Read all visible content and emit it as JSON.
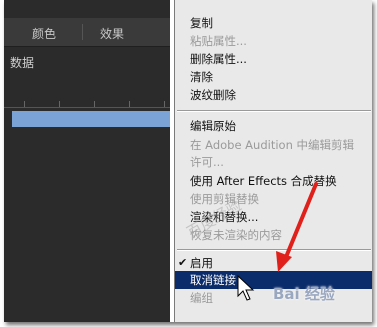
{
  "left_panel": {
    "tabs": [
      "颜色",
      "效果"
    ],
    "meta_label": "数据",
    "clip_color": "#7ba3d6"
  },
  "menu": {
    "items": [
      {
        "label": "复制",
        "enabled": true
      },
      {
        "label": "粘贴属性...",
        "enabled": false
      },
      {
        "label": "删除属性...",
        "enabled": true
      },
      {
        "label": "清除",
        "enabled": true
      },
      {
        "label": "波纹删除",
        "enabled": true
      },
      {
        "label": "编辑原始",
        "enabled": true
      },
      {
        "label": "在 Adobe Audition 中编辑剪辑",
        "enabled": false
      },
      {
        "label": "许可...",
        "enabled": false
      },
      {
        "label": "使用 After Effects 合成替换",
        "enabled": true
      },
      {
        "label": "使用剪辑替换",
        "enabled": false
      },
      {
        "label": "渲染和替换...",
        "enabled": true
      },
      {
        "label": "恢复未渲染的内容",
        "enabled": false
      },
      {
        "label": "启用",
        "enabled": true,
        "checked": true
      },
      {
        "label": "取消链接",
        "enabled": true,
        "selected": true
      },
      {
        "label": "编组",
        "enabled": false
      }
    ],
    "selected_color": "#0b2c6b"
  },
  "annotation": {
    "arrow_color": "#e0201a",
    "watermark": "百度经验",
    "logo": "Bai 经验"
  }
}
